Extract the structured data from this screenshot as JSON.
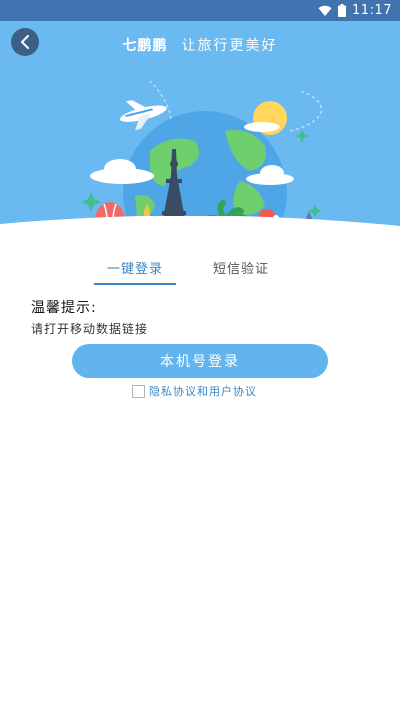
{
  "status_bar": {
    "time": "11:17",
    "icons": [
      "wifi-icon",
      "battery-icon"
    ]
  },
  "header": {
    "back_icon": "chevron-left-icon",
    "app_name": "七鹏鹏",
    "slogan": "让旅行更美好"
  },
  "tabs": [
    {
      "label": "一键登录",
      "active": true
    },
    {
      "label": "短信验证",
      "active": false
    }
  ],
  "hint": {
    "title": "温馨提示:",
    "text": "请打开移动数据链接"
  },
  "login_button": {
    "label": "本机号登录"
  },
  "agreement": {
    "label": "隐私协议和用户协议",
    "checked": false
  },
  "colors": {
    "header_bg": "#6bb9f1",
    "status_bar": "#3f74b1",
    "accent": "#3a86c8",
    "button": "#62b4ef"
  }
}
